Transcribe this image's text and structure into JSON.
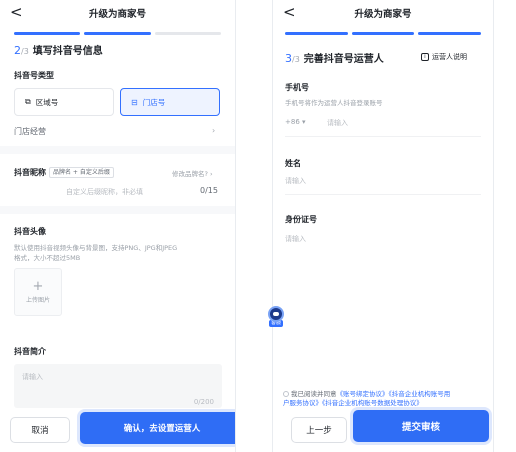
{
  "left": {
    "title": "升级为商家号",
    "back": "<",
    "step": {
      "num": "2",
      "den": "/3",
      "text": "填写抖音号信息"
    },
    "type_label": "抖音号类型",
    "options": [
      {
        "label": "区域号",
        "icon": "⧉"
      },
      {
        "label": "门店号",
        "icon": "⊟"
      }
    ],
    "store_ops": "门店经营",
    "nickname_label": "抖音昵称",
    "nickname_badge": "品牌名 + 自定义后缀",
    "nickname_change": "修改品牌名?",
    "nickname_placeholder": "自定义后缀昵称，非必填",
    "nickname_count": "0/15",
    "avatar_label": "抖音头像",
    "avatar_hint_1": "默认使用抖音视频头像与背景图，支持PNG、JPG和JPEG",
    "avatar_hint_2": "格式，大小不超过5MB",
    "upload_label": "上传图片",
    "intro_label": "抖音简介",
    "intro_placeholder": "请输入",
    "intro_count": "0/200",
    "cancel": "取消",
    "confirm": "确认，去设置运营人"
  },
  "right": {
    "title": "升级为商家号",
    "back": "<",
    "step": {
      "num": "3",
      "den": "/3",
      "text": "完善抖音号运营人"
    },
    "operator_info": "运营人说明",
    "phone_label": "手机号",
    "phone_hint": "手机号将作为运营人抖音登录账号",
    "country_code": "+86",
    "phone_placeholder": "请输入",
    "name_label": "姓名",
    "name_placeholder": "请输入",
    "id_label": "身份证号",
    "id_placeholder": "请输入",
    "agree_prefix": "我已阅读并同意",
    "agree_link_1": "《账号绑定协议》《抖音企业机构账号用",
    "agree_link_2": "户服务协议》《抖音企业机构账号数据处理协议》",
    "prev": "上一步",
    "submit": "提交审核"
  },
  "service_tag": "客服"
}
